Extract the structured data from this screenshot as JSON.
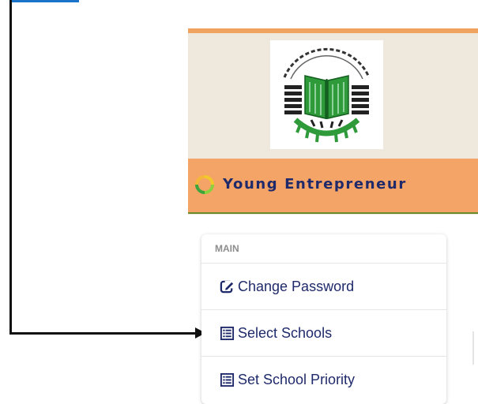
{
  "banner": {
    "brand_name": "Young Entrepreneur"
  },
  "menu": {
    "header": "MAIN",
    "items": [
      {
        "label": "Change Password",
        "icon": "edit-icon"
      },
      {
        "label": "Select Schools",
        "icon": "list-icon"
      },
      {
        "label": "Set School Priority",
        "icon": "list-icon"
      }
    ]
  },
  "colors": {
    "banner_top_accent": "#f0a35e",
    "brand_bar": "#f5a467",
    "brand_text": "#1f2a6b",
    "menu_text": "#1f2a6b",
    "menu_header_text": "#8d8d8d",
    "logo_green": "#2f9a3a",
    "arrow": "#111111"
  }
}
